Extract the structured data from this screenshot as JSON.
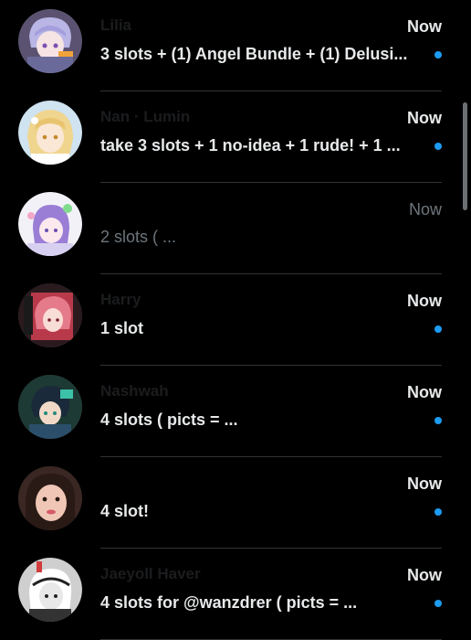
{
  "colors": {
    "background": "#000000",
    "text": "#e7e9ea",
    "muted": "#6e767d",
    "unread_dot": "#1d9bf0",
    "divider": "#2f3336"
  },
  "conversations": [
    {
      "name": "Lilia",
      "time": "Now",
      "preview": "3 slots + (1) Angel Bundle + (1) Delusi...",
      "unread": true,
      "avatar": "anime-avatar"
    },
    {
      "name": "Nan · Lumin",
      "time": "Now",
      "preview": "take 3 slots + 1 no-idea + 1 rude! + 1 ...",
      "unread": true,
      "avatar": "anime-avatar"
    },
    {
      "name": "",
      "time": "Now",
      "preview": "2 slots ( ...",
      "unread": false,
      "avatar": "anime-avatar"
    },
    {
      "name": "Harry",
      "time": "Now",
      "preview": "1 slot",
      "unread": true,
      "avatar": "anime-avatar"
    },
    {
      "name": "Nashwah",
      "time": "Now",
      "preview": "4 slots ( picts = ...",
      "unread": true,
      "avatar": "anime-avatar"
    },
    {
      "name": "",
      "time": "Now",
      "preview": "4 slot!",
      "unread": true,
      "avatar": "photo-avatar"
    },
    {
      "name": "Jaeyoll Haver",
      "time": "Now",
      "preview": "4 slots for @wanzdrer ( picts = ...",
      "unread": true,
      "avatar": "anime-avatar"
    }
  ]
}
